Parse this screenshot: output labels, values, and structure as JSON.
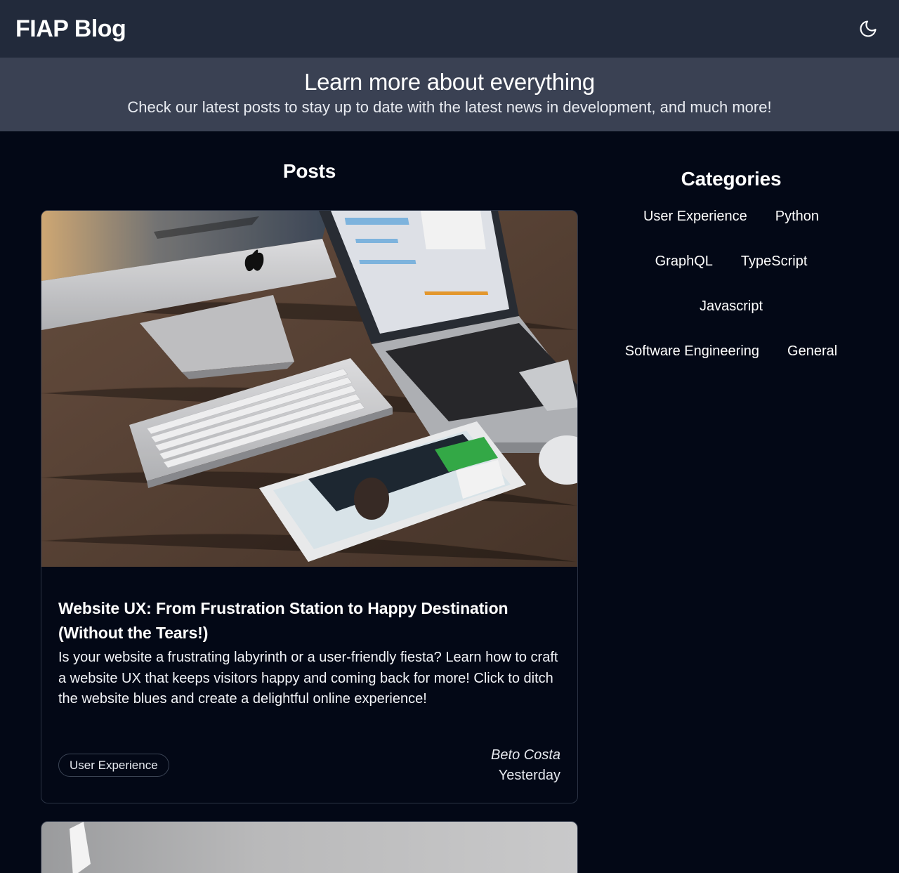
{
  "header": {
    "brand": "FIAP Blog",
    "theme_icon": "moon-icon"
  },
  "hero": {
    "title": "Learn more about everything",
    "subtitle": "Check our latest posts to stay up to date with the latest news in development, and much more!"
  },
  "posts": {
    "heading": "Posts",
    "items": [
      {
        "title": "Website UX: From Frustration Station to Happy Destination (Without the Tears!)",
        "excerpt": "Is your website a frustrating labyrinth or a user-friendly fiesta? Learn how to craft a website UX that keeps visitors happy and coming back for more! Click to ditch the website blues and create a delightful online experience!",
        "tag": "User Experience",
        "author": "Beto Costa",
        "date": "Yesterday"
      }
    ]
  },
  "categories": {
    "heading": "Categories",
    "items": [
      "User Experience",
      "Python",
      "GraphQL",
      "TypeScript",
      "Javascript",
      "Software Engineering",
      "General"
    ]
  },
  "colors": {
    "background": "#030816",
    "topbar": "#222a3b",
    "hero": "#3a4153",
    "card_border": "#2b3344"
  }
}
